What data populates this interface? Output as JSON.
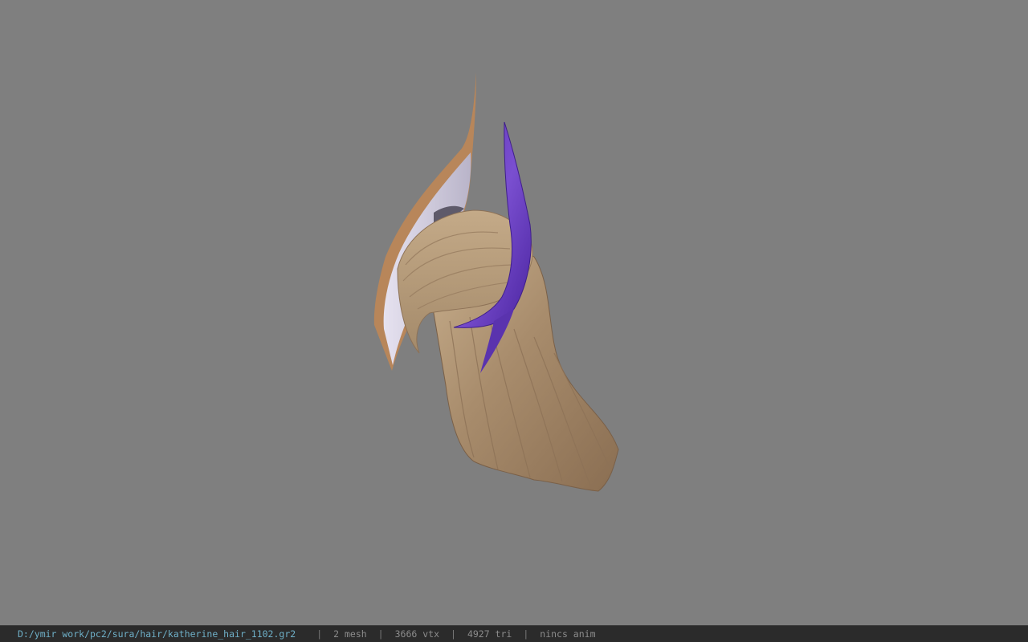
{
  "viewer": {
    "file_path": "D:/ymir work/pc2/sura/hair/katherine_hair_1102.gr2",
    "separator": "|",
    "mesh_count": "2 mesh",
    "vertex_count": "3666 vtx",
    "triangle_count": "4927 tri",
    "anim_status": "nincs anim"
  },
  "colors": {
    "background": "#7f7f7f",
    "status_bar": "#2b2b2b",
    "path_text": "#6fb0c8",
    "hair": "#a88c6c",
    "hair_light": "#c9b08e",
    "horn_purple": "#6a3fc0",
    "blade_white": "#dcd8e8",
    "blade_edge": "#b8865a"
  },
  "model": {
    "subject": "hair-model-with-horns"
  }
}
